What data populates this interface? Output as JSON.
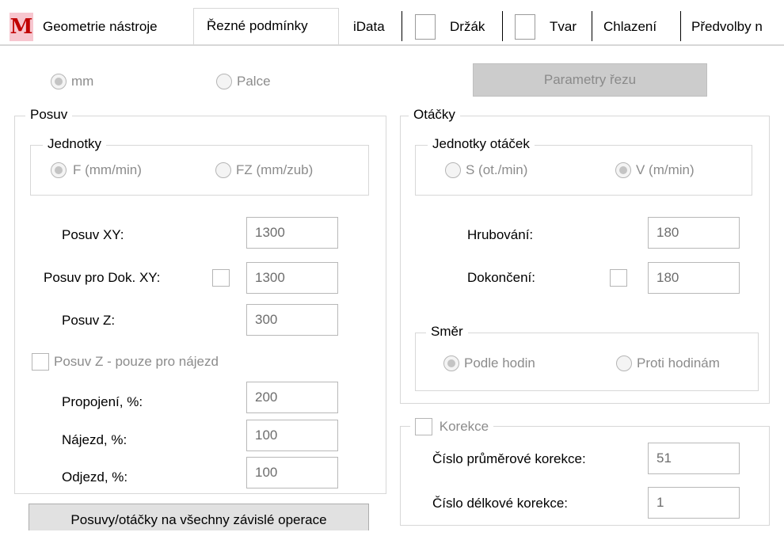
{
  "tabs": {
    "app_icon_glyph": "M",
    "items": [
      "Geometrie nástroje",
      "Řezné podmínky",
      "iData",
      "Držák",
      "Tvar",
      "Chlazení",
      "Předvolby n"
    ]
  },
  "units": {
    "mm": "mm",
    "inches": "Palce",
    "cut_params_button": "Parametry řezu"
  },
  "feed": {
    "title": "Posuv",
    "units_title": "Jednotky",
    "unit_f": "F (mm/min)",
    "unit_fz": "FZ (mm/zub)",
    "feed_xy_label": "Posuv XY:",
    "feed_xy_value": "1300",
    "feed_finish_xy_label": "Posuv pro Dok. XY:",
    "feed_finish_xy_value": "1300",
    "feed_z_label": "Posuv Z:",
    "feed_z_value": "300",
    "feed_z_approach_only": "Posuv Z - pouze pro nájezd",
    "link_label": "Propojení, %:",
    "link_value": "200",
    "approach_label": "Nájezd, %:",
    "approach_value": "100",
    "retract_label": "Odjezd, %:",
    "retract_value": "100"
  },
  "speed": {
    "title": "Otáčky",
    "units_title": "Jednotky otáček",
    "unit_s": "S (ot./min)",
    "unit_v": "V (m/min)",
    "roughing_label": "Hrubování:",
    "roughing_value": "180",
    "finishing_label": "Dokončení:",
    "finishing_value": "180",
    "direction_title": "Směr",
    "cw": "Podle hodin",
    "ccw": "Proti hodinám"
  },
  "correction": {
    "title": "Korekce",
    "diameter_label": "Číslo průměrové korekce:",
    "diameter_value": "51",
    "length_label": "Číslo délkové korekce:",
    "length_value": "1"
  },
  "apply_all_button": "Posuvy/otáčky na všechny závislé operace"
}
